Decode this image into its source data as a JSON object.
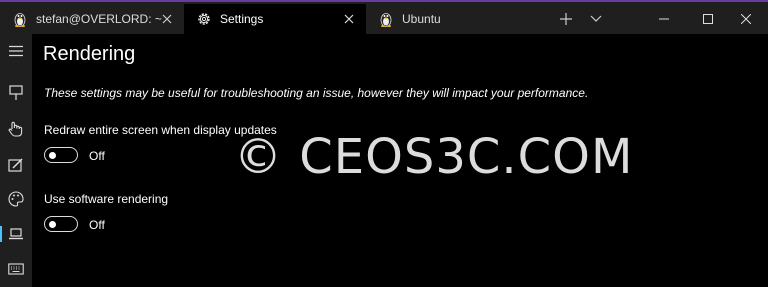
{
  "tabs": [
    {
      "label": "stefan@OVERLORD: ~",
      "icon": "linux-penguin-icon",
      "active": false
    },
    {
      "label": "Settings",
      "icon": "gear-icon",
      "active": true
    },
    {
      "label": "Ubuntu",
      "icon": "linux-penguin-icon",
      "active": false
    }
  ],
  "window_controls": [
    "new-tab",
    "dropdown",
    "minimize",
    "maximize",
    "close"
  ],
  "sidebar": {
    "items": [
      {
        "icon": "hamburger-menu-icon"
      },
      {
        "icon": "startup-icon"
      },
      {
        "icon": "interaction-icon"
      },
      {
        "icon": "appearance-icon"
      },
      {
        "icon": "color-schemes-icon"
      },
      {
        "icon": "rendering-icon",
        "selected": true
      },
      {
        "icon": "keyboard-icon"
      }
    ],
    "accent": "#4cc2ff"
  },
  "page": {
    "title": "Rendering",
    "description": "These settings may be useful for troubleshooting an issue, however they will impact your performance.",
    "settings": [
      {
        "label": "Redraw entire screen when display updates",
        "state": "Off"
      },
      {
        "label": "Use software rendering",
        "state": "Off"
      }
    ]
  },
  "watermark": "© CEOS3C.COM",
  "colors": {
    "titlebar": "#1f1f1f",
    "background": "#000000",
    "top_accent": "#6b3aa0"
  }
}
